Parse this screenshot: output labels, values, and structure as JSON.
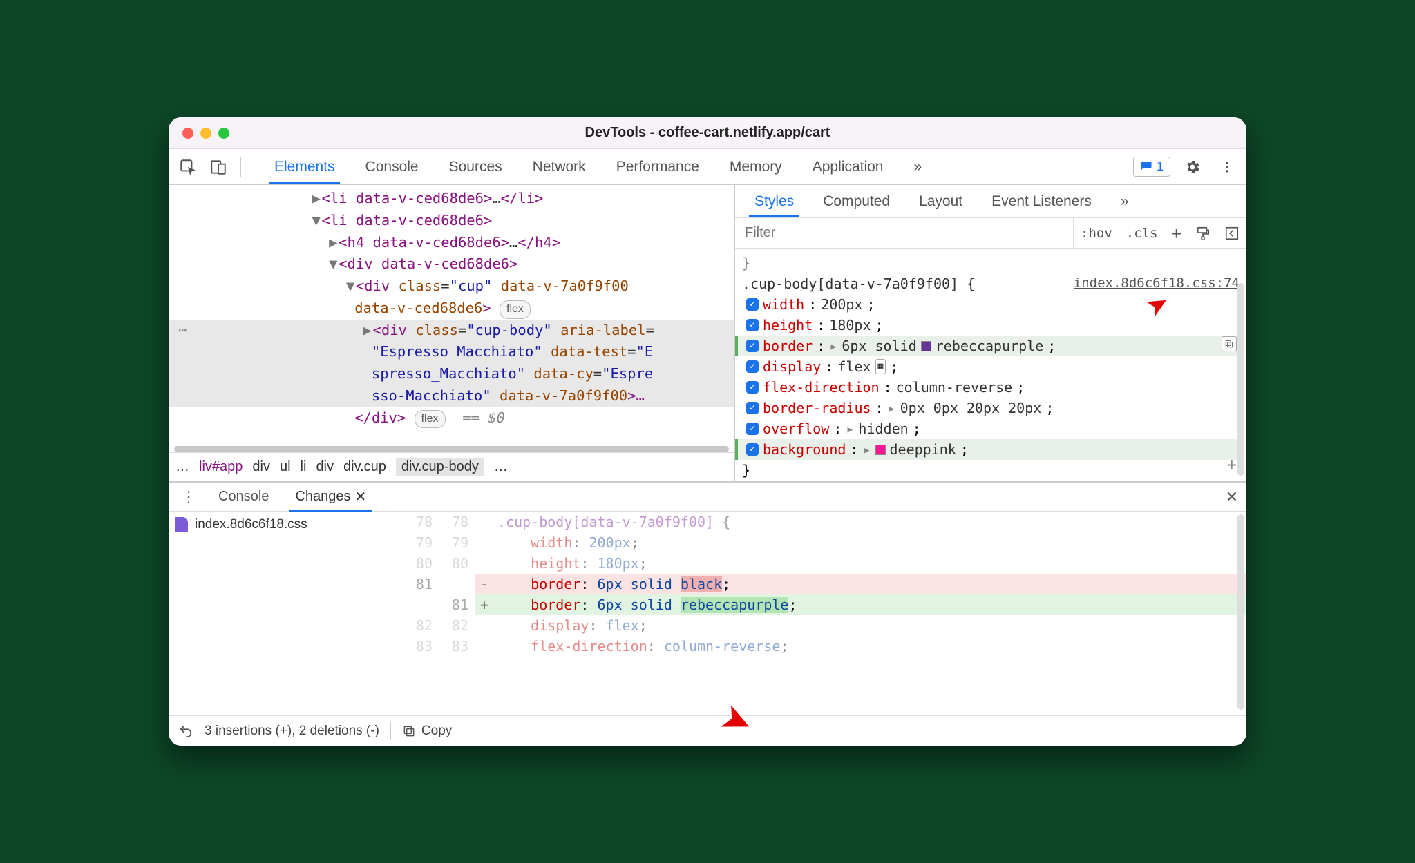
{
  "window": {
    "title": "DevTools - coffee-cart.netlify.app/cart"
  },
  "toolbar": {
    "tabs": [
      "Elements",
      "Console",
      "Sources",
      "Network",
      "Performance",
      "Memory",
      "Application"
    ],
    "issues_count": "1"
  },
  "dom": {
    "line1_open": "<li data-v-ced68de6>",
    "line1_txt": "…",
    "line1_close": "</li>",
    "line2": "<li data-v-ced68de6>",
    "line3_open": "<h4 data-v-ced68de6>",
    "line3_txt": "…",
    "line3_close": "</h4>",
    "line4": "<div data-v-ced68de6>",
    "line5a": "<div",
    "line5_class": "class",
    "line5_eq": "=",
    "line5_cv": "\"cup\"",
    "line5_attr": "data-v-7a0f9f00",
    "line6_attr": "data-v-ced68de6",
    "line6_close": ">",
    "line6_badge": "flex",
    "sel_a": "<div",
    "sel_class": "class",
    "sel_cv": "\"cup-body\"",
    "sel_aria": "aria-label",
    "sel_eq": "=",
    "sel_l2": "\"Espresso Macchiato\"",
    "sel_dt": "data-test",
    "sel_dtv": "\"E",
    "sel_l3": "spresso_Macchiato\"",
    "sel_dc": "data-cy",
    "sel_dcv": "\"Espre",
    "sel_l4": "sso-Macchiato\"",
    "sel_dv": "data-v-7a0f9f00",
    "sel_end": ">…",
    "close_div": "</div>",
    "close_badge": "flex",
    "close_eq": "== ",
    "close_d": "$0"
  },
  "breadcrumbs": {
    "items": [
      "…",
      "liv#app",
      "div",
      "ul",
      "li",
      "div",
      "div.cup",
      "div.cup-body",
      "…"
    ]
  },
  "styles": {
    "subtabs": [
      "Styles",
      "Computed",
      "Layout",
      "Event Listeners"
    ],
    "filter_placeholder": "Filter",
    "hov": ":hov",
    "cls": ".cls",
    "selector": ".cup-body[data-v-7a0f9f00]",
    "brace": " {",
    "source": "index.8d6c6f18.css:74",
    "props": [
      {
        "n": "width",
        "v": "200px"
      },
      {
        "n": "height",
        "v": "180px"
      },
      {
        "n": "border",
        "v": "6px solid ",
        "swatch": "#663399",
        "v2": "rebeccapurple",
        "exp": true,
        "hi": true,
        "copy": true
      },
      {
        "n": "display",
        "v": "flex",
        "grid": true
      },
      {
        "n": "flex-direction",
        "v": "column-reverse"
      },
      {
        "n": "border-radius",
        "v": "0px 0px 20px 20px",
        "exp": true
      },
      {
        "n": "overflow",
        "v": "hidden",
        "exp": true
      },
      {
        "n": "background",
        "v": "",
        "swatch": "#ff1493",
        "v2": "deeppink",
        "exp": true,
        "hi": true
      }
    ],
    "close": "}"
  },
  "drawer": {
    "tabs": [
      "Console",
      "Changes"
    ],
    "file": "index.8d6c6f18.css",
    "lines": [
      {
        "l": "78",
        "r": "78",
        "code_sel": ".cup-body[data-v-7a0f9f00]",
        "code_br": " {",
        "faded": true
      },
      {
        "l": "79",
        "r": "79",
        "pad": "    ",
        "p": "width",
        "v": "200px",
        "faded": true
      },
      {
        "l": "80",
        "r": "80",
        "pad": "    ",
        "p": "height",
        "v": "180px",
        "faded": true
      },
      {
        "l": "81",
        "r": "",
        "sign": "-",
        "pad": "    ",
        "p": "border",
        "pre": "6px solid ",
        "hl": "black",
        "type": "del"
      },
      {
        "l": "",
        "r": "81",
        "sign": "+",
        "pad": "    ",
        "p": "border",
        "pre": "6px solid ",
        "hl": "rebeccapurple",
        "type": "add"
      },
      {
        "l": "82",
        "r": "82",
        "pad": "    ",
        "p": "display",
        "v": "flex",
        "faded": true
      },
      {
        "l": "83",
        "r": "83",
        "pad": "    ",
        "p": "flex-direction",
        "v": "column-reverse",
        "faded": true
      }
    ],
    "summary": "3 insertions (+), 2 deletions (-)",
    "copy": "Copy"
  }
}
